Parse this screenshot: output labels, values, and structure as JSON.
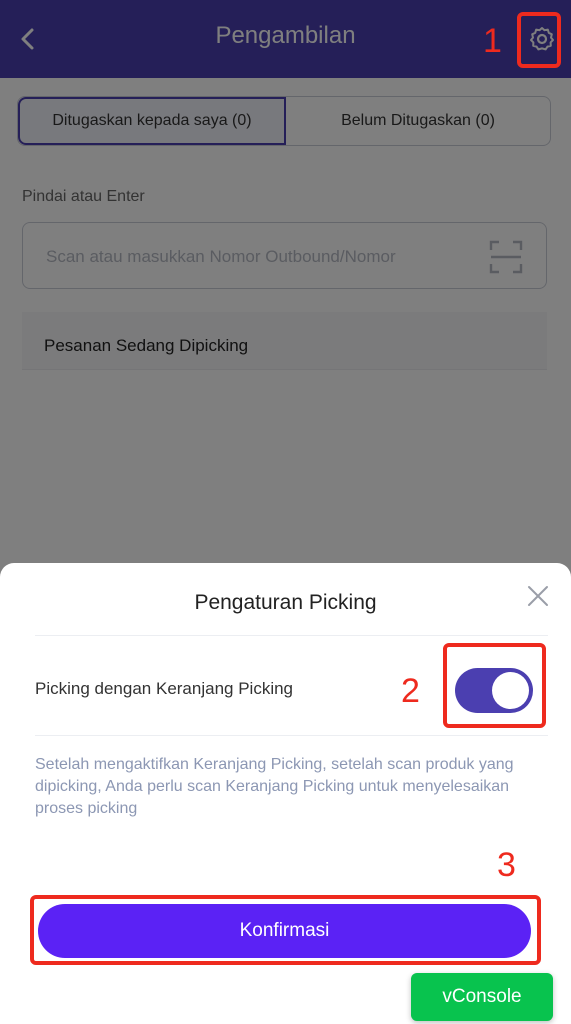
{
  "header": {
    "title": "Pengambilan"
  },
  "tabs": [
    {
      "label": "Ditugaskan kepada saya (0)"
    },
    {
      "label": "Belum Ditugaskan (0)"
    }
  ],
  "scan": {
    "label": "Pindai atau Enter",
    "placeholder": "Scan atau masukkan Nomor Outbound/Nomor"
  },
  "picking_in_progress": {
    "label": "Pesanan Sedang Dipicking"
  },
  "settings_sheet": {
    "title": "Pengaturan Picking",
    "toggle_label": "Picking dengan Keranjang Picking",
    "toggle_on": true,
    "description": "Setelah mengaktifkan Keranjang Picking, setelah scan produk yang dipicking, Anda perlu scan Keranjang Picking untuk menyelesaikan proses picking",
    "confirm_label": "Konfirmasi"
  },
  "annotations": {
    "n1": "1",
    "n2": "2",
    "n3": "3"
  },
  "vconsole": {
    "label": "vConsole"
  },
  "colors": {
    "header": "#4b3fb0",
    "confirm_button": "#5b22f5",
    "toggle_on": "#4b3fb0",
    "annotation_red": "#ee2a1e",
    "vconsole_green": "#08c34e"
  },
  "icons": {
    "back": "chevron-left-icon",
    "settings": "gear-icon",
    "scan": "scan-frame-icon",
    "close": "close-icon"
  }
}
